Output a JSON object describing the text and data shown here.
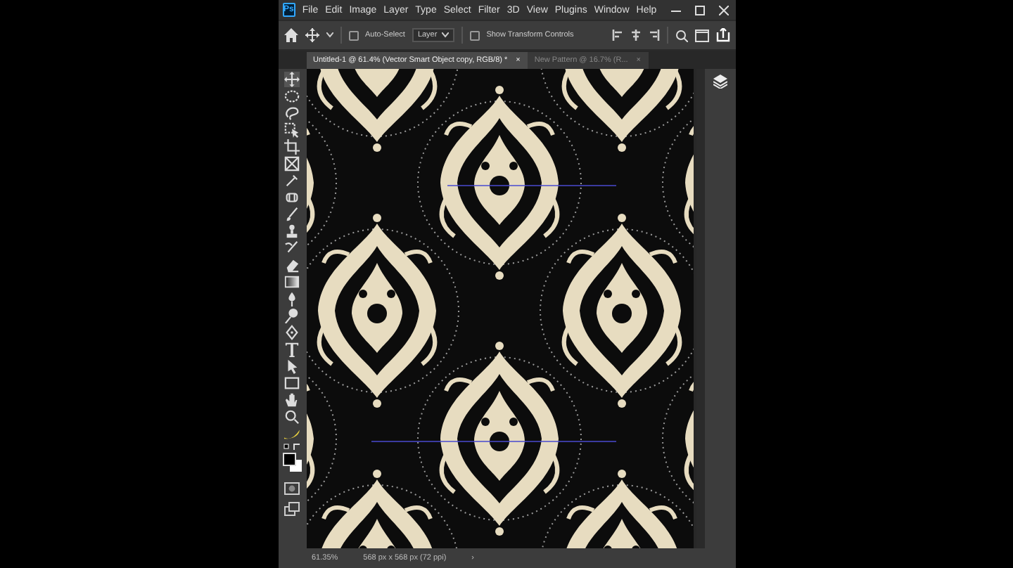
{
  "menu_bar": {
    "app_icon": "Ps",
    "items": [
      "File",
      "Edit",
      "Image",
      "Layer",
      "Type",
      "Select",
      "Filter",
      "3D",
      "View",
      "Plugins",
      "Window",
      "Help"
    ]
  },
  "options_bar": {
    "auto_select": {
      "label": "Auto-Select",
      "checked": false
    },
    "layer_dropdown": "Layer",
    "transform_controls": {
      "label": "Show Transform Controls",
      "checked": false
    }
  },
  "tabs": [
    {
      "label": "Untitled-1 @ 61.4% (Vector Smart Object copy, RGB/8) *",
      "close": "×",
      "selected": true
    },
    {
      "label": "New Pattern @ 16.7% (R...",
      "close": "×",
      "selected": false
    }
  ],
  "status_bar": {
    "zoom": "61.35%",
    "document_size": "568 px x 568 px (72 ppi)",
    "arrow": "›"
  }
}
